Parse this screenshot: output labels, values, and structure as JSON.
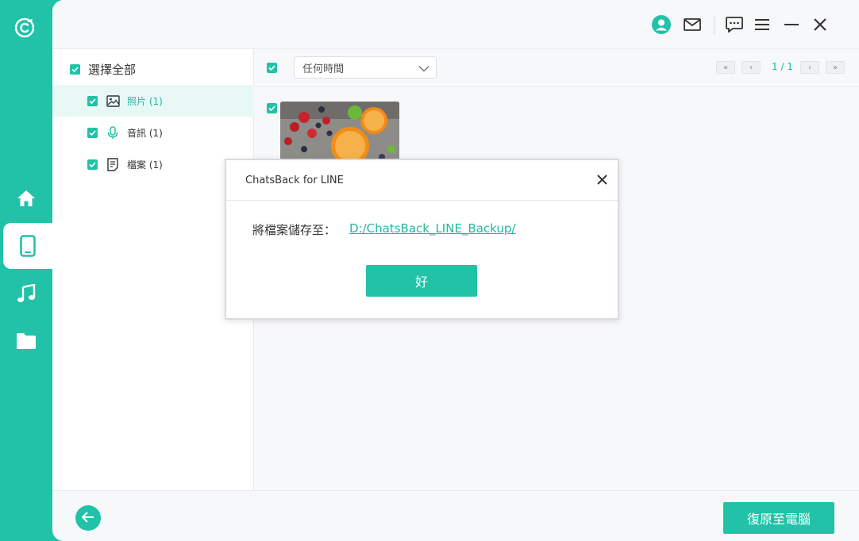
{
  "app": {
    "accent": "#21c2a8"
  },
  "rail": {
    "items": [
      {
        "icon": "home-icon"
      },
      {
        "icon": "phone-icon",
        "active": true
      },
      {
        "icon": "music-icon"
      },
      {
        "icon": "folder-icon"
      }
    ]
  },
  "topbar": {
    "icons": [
      "user-icon",
      "mail-icon",
      "feedback-icon",
      "menu-icon",
      "minimize-icon",
      "close-icon"
    ]
  },
  "categories": {
    "select_all_label": "選擇全部",
    "items": [
      {
        "label": "照片 (1)",
        "icon": "image-icon",
        "active": true
      },
      {
        "label": "音訊 (1)",
        "icon": "microphone-icon",
        "active": false
      },
      {
        "label": "檔案 (1)",
        "icon": "document-icon",
        "active": false
      }
    ]
  },
  "toolbar": {
    "time_filter": "任何時間",
    "page_indicator": "1 / 1",
    "first_page": "«",
    "prev_page": "‹",
    "next_page": "›",
    "last_page": "»"
  },
  "bottom": {
    "restore_label": "復原至電腦"
  },
  "dialog": {
    "title": "ChatsBack for LINE",
    "message": "將檔案儲存至：",
    "path": "D:/ChatsBack_LINE_Backup/",
    "ok_label": "好"
  }
}
